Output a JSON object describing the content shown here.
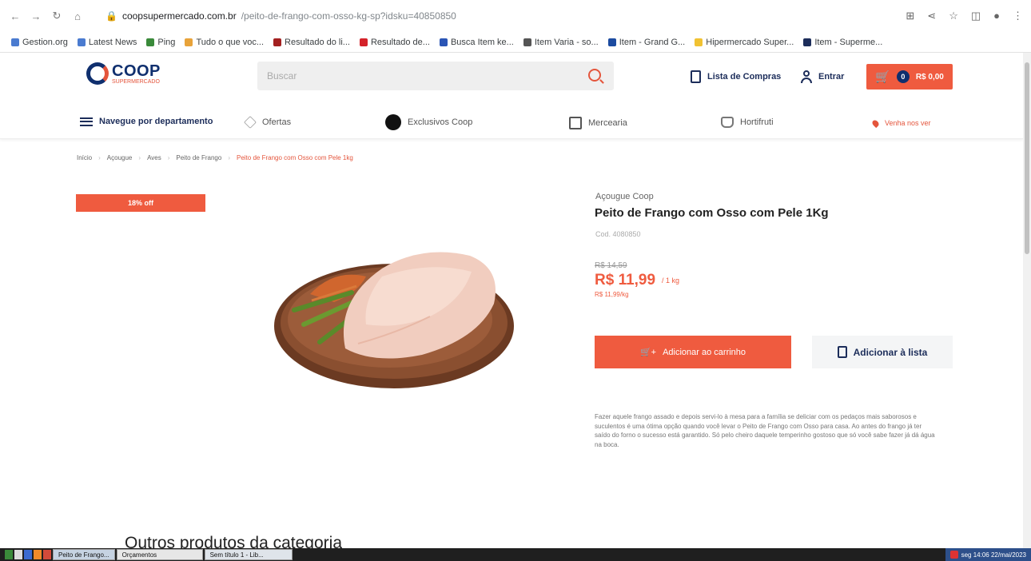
{
  "browser": {
    "url_host": "coopsupermercado.com.br",
    "url_path": "/peito-de-frango-com-osso-kg-sp?idsku=40850850",
    "bookmarks": [
      "Gestion.org",
      "Latest News",
      "Ping",
      "Tudo o que voc...",
      "Resultado do li...",
      "Resultado de...",
      "Busca Item ke...",
      "Item Varia - so...",
      "Item - Grand G...",
      "Hipermercado Super...",
      "Item - Superme..."
    ],
    "bookmark_colors": [
      "#4a7bd0",
      "#4a7bd0",
      "#3a8a3a",
      "#e8a33a",
      "#a32020",
      "#d4222a",
      "#2a55b5",
      "#555555",
      "#1c4ba0",
      "#f1c232",
      "#1c2d5a"
    ]
  },
  "header": {
    "logo_text": "COOP",
    "logo_sub": "SUPERMERCADO",
    "search_placeholder": "Buscar",
    "shopping_list": "Lista de Compras",
    "login": "Entrar",
    "cart_count": "0",
    "cart_label": "R$ 0,00",
    "accent_color": "#ef5b3f",
    "brand_color": "#0f2f6e"
  },
  "dept_nav": {
    "browse": "Navegue por departamento",
    "offers": "Ofertas",
    "exclusive": "Exclusivos Coop",
    "kits": "Mercearia",
    "hortifruti": "Hortifruti",
    "store": "Venha nos ver"
  },
  "breadcrumb": [
    "Início",
    "Açougue",
    "Aves",
    "Peito de Frango",
    "Peito de Frango com Osso com Pele 1kg"
  ],
  "product": {
    "discount": "18% off",
    "brand": "Açougue Coop",
    "title": "Peito de Frango com Osso com Pele 1Kg",
    "sku": "Cod. 4080850",
    "old_price": "R$ 14,59",
    "price": "R$ 11,99",
    "price_unit": "/ 1 kg",
    "price_per_kg": "R$ 11,99/kg",
    "add_to_cart": "Adicionar ao carrinho",
    "add_to_list": "Adicionar à lista",
    "description": "Fazer aquele frango assado e depois servi-lo à mesa para a família se deliciar com os pedaços mais saborosos e suculentos é uma ótima opção quando você levar o Peito de Frango com Osso para casa. Ao antes do frango já ter saído do forno o sucesso está garantido. Só pelo cheiro daquele temperinho gostoso que só você sabe fazer já dá água na boca."
  },
  "section": {
    "heading": "Outros produtos da categoria"
  },
  "taskbar": {
    "tasks": [
      "Peito de Frango...",
      "Orçamentos",
      "Sem título 1 - Lib..."
    ],
    "clock": "seg 14:06 22/mai/2023"
  }
}
